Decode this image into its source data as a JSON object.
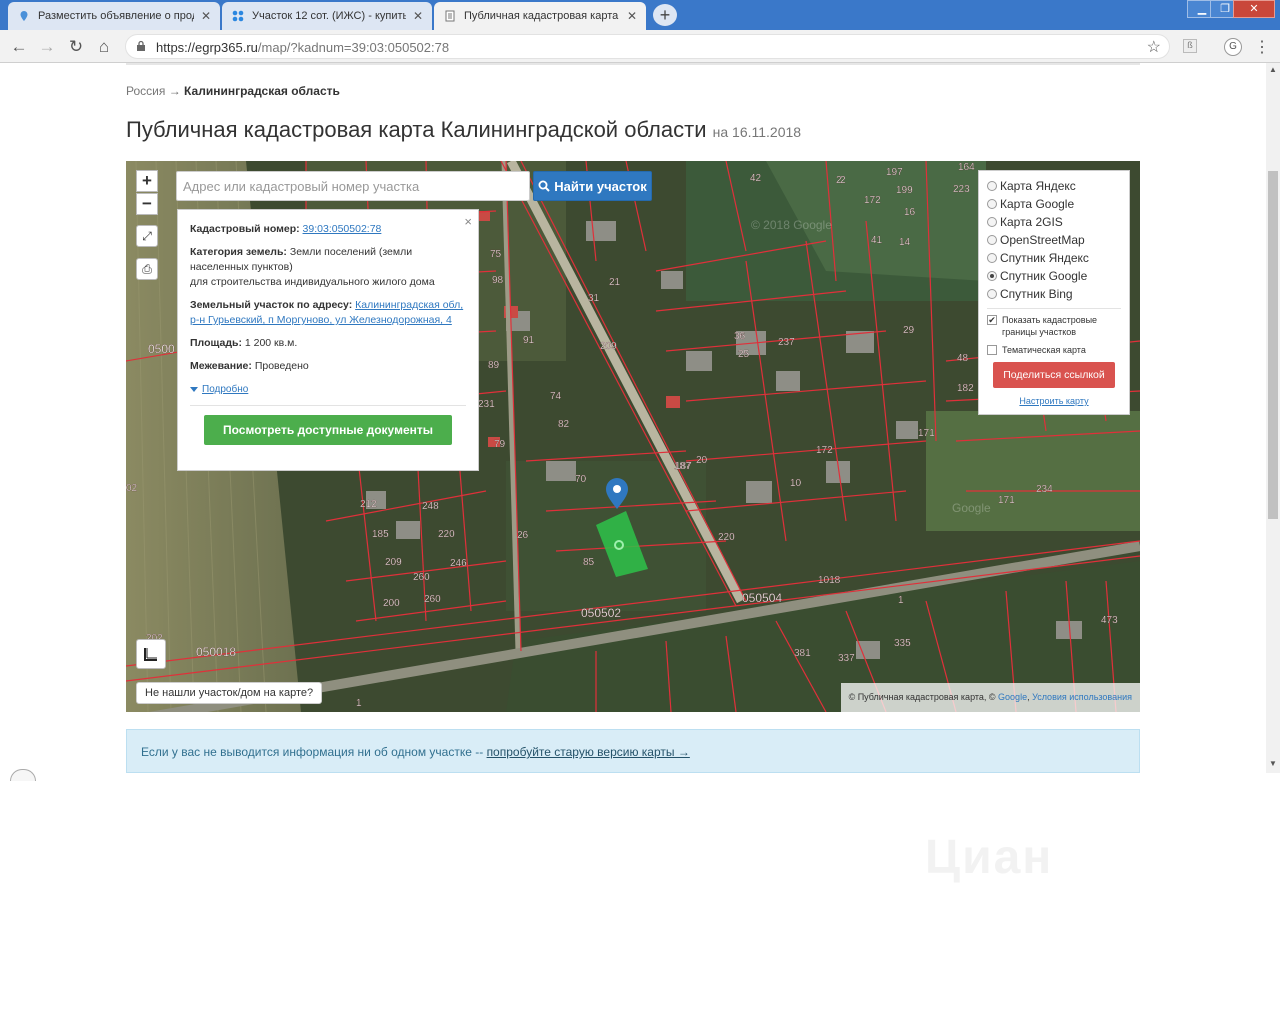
{
  "browser": {
    "tabs": [
      {
        "title": "Разместить объявление о прод",
        "close": "✕"
      },
      {
        "title": "Участок 12 сот. (ИЖС) - купить",
        "close": "✕"
      },
      {
        "title": "Публичная кадастровая карта К",
        "close": "✕"
      }
    ],
    "new_tab": "+",
    "window_controls": {
      "minimize": "▁",
      "maximize": "❐",
      "close": "✕"
    },
    "nav": {
      "back": "←",
      "forward": "→",
      "reload": "↻",
      "home": "⌂"
    },
    "url_host": "https://egrp365.ru",
    "url_path": "/map/?kadnum=39:03:050502:78",
    "star": "☆",
    "extension": "ß",
    "profile_initial": "G",
    "menu": "⋮"
  },
  "page": {
    "breadcrumb_root": "Россия",
    "breadcrumb_sep": "→",
    "breadcrumb_current": "Калининградская область",
    "title": "Публичная кадастровая карта Калининградской области",
    "title_date": "на 16.11.2018"
  },
  "map": {
    "zoom_in": "+",
    "zoom_out": "−",
    "fullscreen_icon": "⤢",
    "print_icon": "⎙",
    "search_placeholder": "Адрес или кадастровый номер участка",
    "search_button": "Найти участок",
    "info": {
      "close": "×",
      "kadnum_label": "Кадастровый номер:",
      "kadnum_value": "39:03:050502:78",
      "category_label": "Категория земель:",
      "category_value": "Земли поселений (земли населенных пунктов)",
      "usage": "для строительства индивидуального жилого дома",
      "address_label": "Земельный участок по адресу:",
      "address_value": "Калининградская обл, р-н Гурьевский, п Моргуново, ул Железнодорожная, 4",
      "area_label": "Площадь:",
      "area_value": "1 200 кв.м.",
      "survey_label": "Межевание:",
      "survey_value": "Проведено",
      "more_link": "Подробно",
      "docs_button": "Посмотреть доступные документы"
    },
    "layers": [
      {
        "label": "Карта Яндекс",
        "selected": false
      },
      {
        "label": "Карта Google",
        "selected": false
      },
      {
        "label": "Карта 2GIS",
        "selected": false
      },
      {
        "label": "OpenStreetMap",
        "selected": false
      },
      {
        "label": "Спутник Яндекс",
        "selected": false
      },
      {
        "label": "Спутник Google",
        "selected": true
      },
      {
        "label": "Спутник Bing",
        "selected": false
      }
    ],
    "show_borders_label": "Показать кадастровые границы участков",
    "show_borders_checked": true,
    "thematic_label": "Тематическая карта",
    "thematic_checked": false,
    "share_button": "Поделиться ссылкой",
    "setup_link": "Настроить карту",
    "not_found_button": "Не нашли участок/дом на карте?",
    "attribution_prefix": "© Публичная кадастровая карта, ©",
    "attribution_google": "Google",
    "attribution_terms": "Условия использования",
    "watermark_google": "© 2018 Google",
    "watermark_google2": "Google",
    "parcel_labels": [
      "42",
      "2",
      "164",
      "223",
      "197",
      "172",
      "199",
      "16",
      "14",
      "41",
      "36",
      "237",
      "29",
      "48",
      "182",
      "171",
      "234",
      "172",
      "187",
      "20",
      "10",
      "220",
      "70",
      "26",
      "85",
      "212",
      "248",
      "185",
      "220",
      "209",
      "246",
      "260",
      "200",
      "260",
      "050502",
      "050504",
      "050018",
      "0500",
      "1",
      "1",
      "381",
      "335",
      "337",
      "473",
      "171",
      "89",
      "91",
      "98",
      "75",
      "31",
      "82",
      "74",
      "231",
      "1018",
      "21",
      "02",
      "202",
      "2",
      "79",
      "209",
      "25",
      "187"
    ]
  },
  "notice": {
    "text": "Если у вас не выводится информация ни об одном участке --",
    "link": "попробуйте старую версию карты →"
  },
  "watermark": "Циан",
  "colors": {
    "accent_blue": "#2f78c0",
    "docs_green": "#4cae4c",
    "share_red": "#d9534f",
    "parcel_line": "#e0303a",
    "selected_parcel": "#2ec24a",
    "notice_bg": "#d9edf7"
  }
}
